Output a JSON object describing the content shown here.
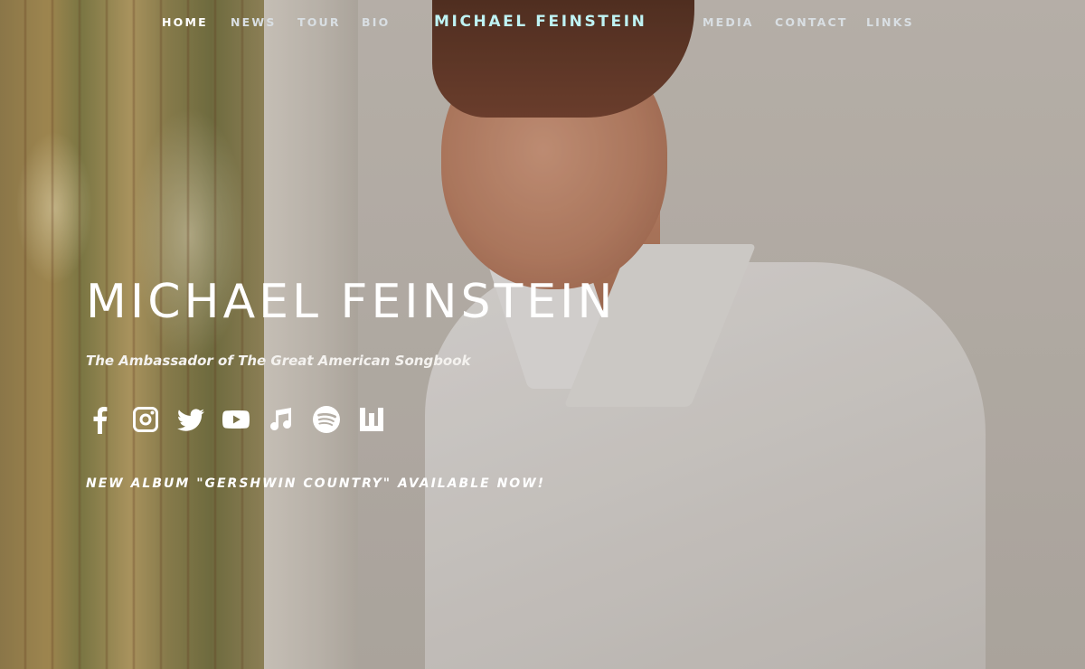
{
  "nav": {
    "left": [
      {
        "label": "HOME",
        "active": true
      },
      {
        "label": "NEWS",
        "active": false
      },
      {
        "label": "TOUR",
        "active": false
      },
      {
        "label": "BIO",
        "active": false
      }
    ],
    "brand": "MICHAEL FEINSTEIN",
    "right": [
      {
        "label": "MEDIA"
      },
      {
        "label": "CONTACT"
      },
      {
        "label": "LINKS"
      }
    ]
  },
  "hero": {
    "title": "MICHAEL FEINSTEIN",
    "tagline": "The Ambassador of The Great American Songbook",
    "announcement": "NEW ALBUM \"GERSHWIN COUNTRY\" AVAILABLE NOW!"
  },
  "social_icons": [
    "facebook-icon",
    "instagram-icon",
    "twitter-icon",
    "youtube-icon",
    "apple-music-icon",
    "spotify-icon",
    "bandsintown-icon"
  ],
  "colors": {
    "brand_accent": "#bff3f4",
    "text_white": "#ffffff",
    "nav_text": "#d9dfe3"
  }
}
